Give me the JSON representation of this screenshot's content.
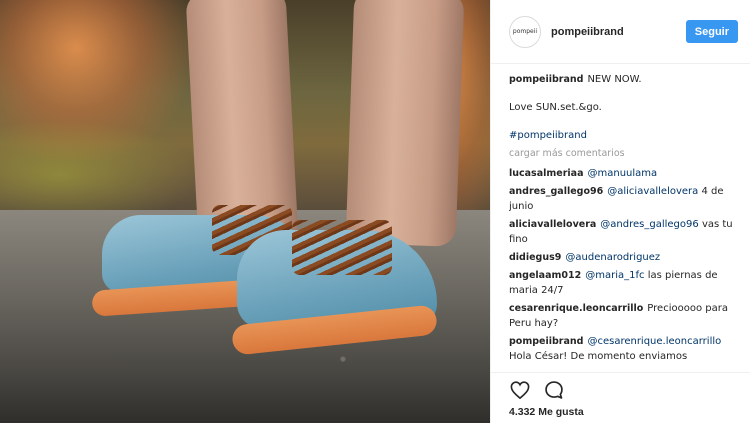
{
  "post": {
    "username": "pompeiibrand",
    "avatar_text": "pompeii",
    "follow_label": "Seguir"
  },
  "caption": {
    "username": "pompeiibrand",
    "line1": "NEW NOW.",
    "line2": "Love SUN.set.&go.",
    "hashtag": "#pompeiibrand"
  },
  "load_more_label": "cargar más comentarios",
  "comments": [
    {
      "user": "lucasalmeriaa",
      "mention": "@manuulama",
      "text": ""
    },
    {
      "user": "andres_gallego96",
      "mention": "@aliciavallelovera",
      "text": "4 de junio"
    },
    {
      "user": "aliciavallelovera",
      "mention": "@andres_gallego96",
      "text": "vas tu fino"
    },
    {
      "user": "didiegus9",
      "mention": "@audenarodriguez",
      "text": ""
    },
    {
      "user": "angelaam012",
      "mention": "@maria_1fc",
      "text": "las piernas de maria 24/7"
    },
    {
      "user": "cesarenrique.leoncarrillo",
      "mention": "",
      "text": "Preciooooo para Peru hay?"
    },
    {
      "user": "pompeiibrand",
      "mention": "@cesarenrique.leoncarrillo",
      "text": "Hola César! De momento enviamos"
    }
  ],
  "actions": {
    "like_icon": "heart-icon",
    "comment_icon": "comment-icon"
  },
  "likes_label": "4.332 Me gusta",
  "colors": {
    "follow_button": "#3897f0",
    "mention": "#003569",
    "muted": "#999999"
  }
}
